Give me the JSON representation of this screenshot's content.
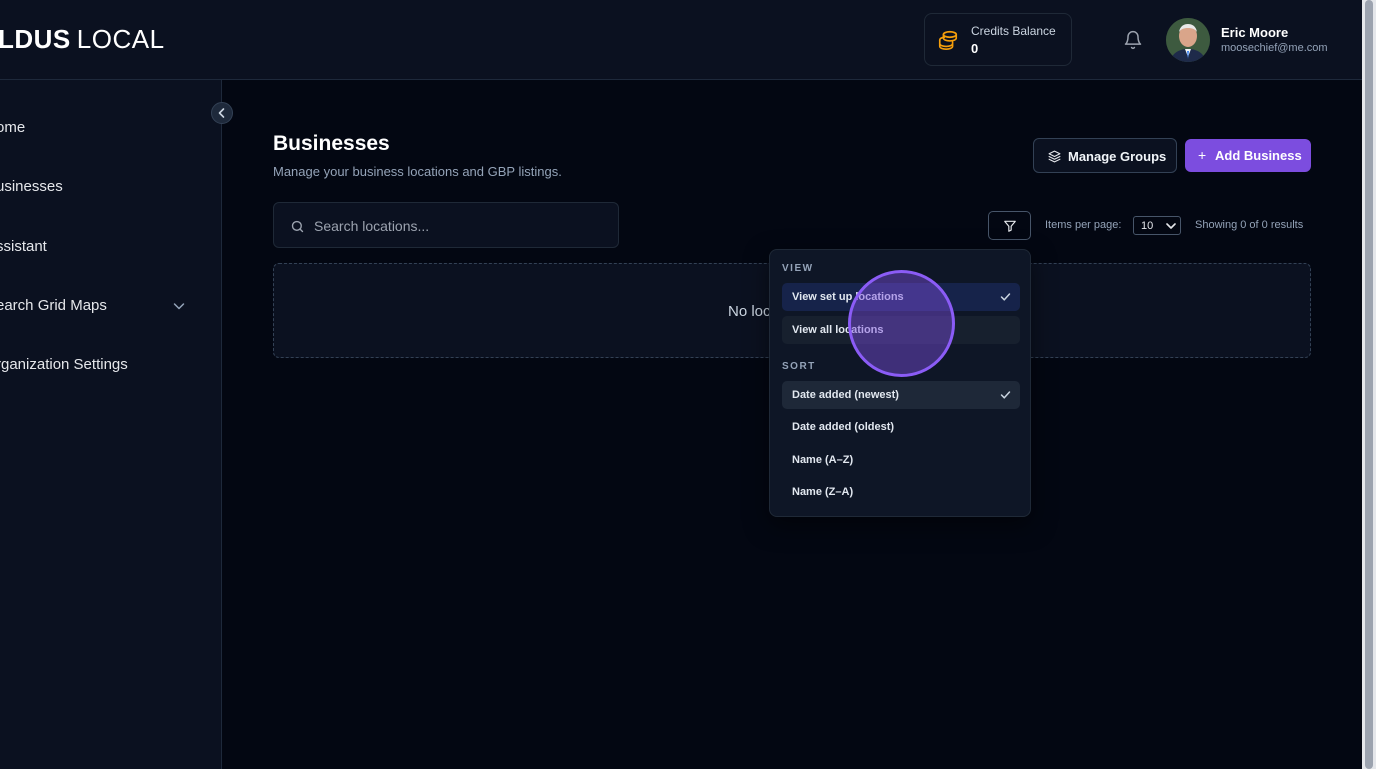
{
  "brand": {
    "name_bold": "LDUS",
    "name_light": "LOCAL"
  },
  "header": {
    "credits_label": "Credits Balance",
    "credits_value": "0",
    "user_name": "Eric Moore",
    "user_email": "moosechief@me.com"
  },
  "sidebar": {
    "items": [
      {
        "label": "ome"
      },
      {
        "label": "usinesses"
      },
      {
        "label": "ssistant"
      },
      {
        "label": "earch Grid Maps"
      },
      {
        "label": "rganization Settings"
      }
    ]
  },
  "main": {
    "title": "Businesses",
    "subtitle": "Manage your business locations and GBP listings.",
    "manage_groups_label": "Manage Groups",
    "add_business_label": "Add Business",
    "search_placeholder": "Search locations...",
    "items_per_page_label": "Items per page:",
    "items_per_page_value": "10",
    "showing_text": "Showing 0 of 0 results",
    "empty_text": "No loc"
  },
  "dropdown": {
    "view_section": "VIEW",
    "view_items": [
      {
        "label": "View set up locations",
        "selected": true
      },
      {
        "label": "View all locations",
        "selected": false
      }
    ],
    "sort_section": "SORT",
    "sort_items": [
      {
        "label": "Date added (newest)",
        "selected": true
      },
      {
        "label": "Date added (oldest)",
        "selected": false
      },
      {
        "label": "Name (A–Z)",
        "selected": false
      },
      {
        "label": "Name (Z–A)",
        "selected": false
      }
    ]
  },
  "colors": {
    "accent": "#7c4ddf",
    "background": "#030712",
    "panel": "#0b1120"
  },
  "icons": [
    "coins-icon",
    "bell-icon",
    "chevron-left-icon",
    "chevron-down-icon",
    "layers-icon",
    "plus-icon",
    "search-icon",
    "filter-icon",
    "check-icon"
  ]
}
